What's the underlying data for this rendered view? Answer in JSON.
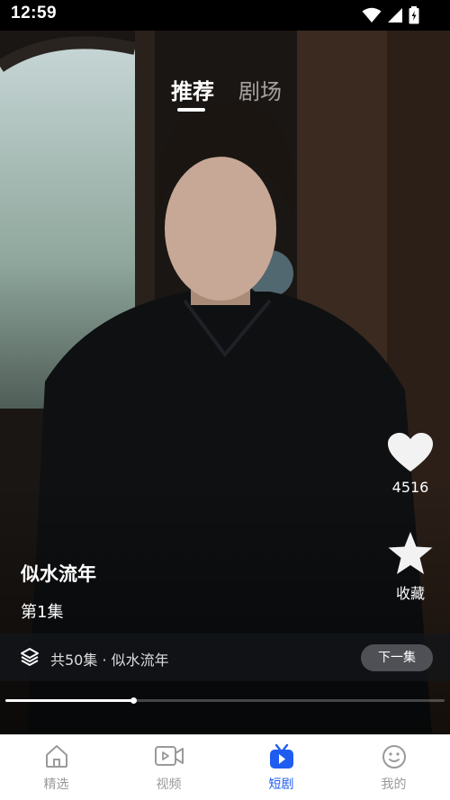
{
  "status_bar": {
    "time": "12:59"
  },
  "top_tabs": [
    {
      "label": "推荐",
      "active": true
    },
    {
      "label": "剧场",
      "active": false
    }
  ],
  "actions": {
    "like_count": "4516",
    "favorite_label": "收藏"
  },
  "drama": {
    "title": "似水流年",
    "episode": "第1集",
    "summary": "共50集 · 似水流年",
    "next_label": "下一集"
  },
  "playback": {
    "progress": 0.29
  },
  "bottom_nav": [
    {
      "label": "精选",
      "icon": "home-icon",
      "active": false
    },
    {
      "label": "视频",
      "icon": "video-icon",
      "active": false
    },
    {
      "label": "短剧",
      "icon": "tv-play-icon",
      "active": true
    },
    {
      "label": "我的",
      "icon": "smiley-icon",
      "active": false
    }
  ],
  "colors": {
    "accent": "#1f5df0",
    "nav_inactive": "#9a9a9a"
  }
}
